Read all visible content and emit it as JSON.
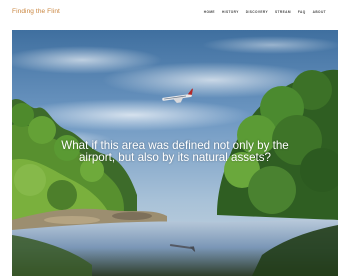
{
  "header": {
    "site_title": "Finding the Flint",
    "nav": [
      {
        "label": "HOME"
      },
      {
        "label": "HISTORY"
      },
      {
        "label": "DISCOVERY"
      },
      {
        "label": "STREAM"
      },
      {
        "label": "FAQ"
      },
      {
        "label": "ABOUT"
      }
    ]
  },
  "hero": {
    "headline": "What if this area was defined not only by the airport, but also by its natural assets?"
  }
}
